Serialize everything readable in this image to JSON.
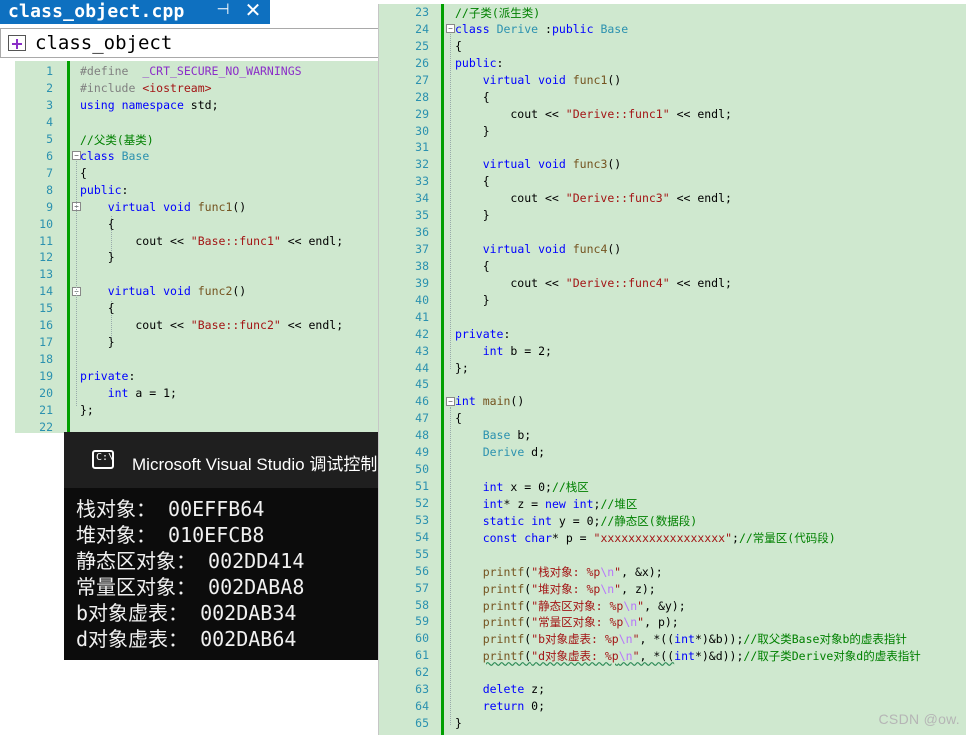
{
  "editor": {
    "tab_title": "class_object.cpp",
    "pin_glyph": "⊣",
    "close_glyph": "✕",
    "nav_class": "class_object"
  },
  "left_lines": [
    {
      "n": "1",
      "segs": [
        [
          "pp",
          "#define  "
        ],
        [
          "mac",
          "_CRT_SECURE_NO_WARNINGS"
        ]
      ]
    },
    {
      "n": "2",
      "segs": [
        [
          "pp",
          "#include "
        ],
        [
          "str",
          "<iostream>"
        ]
      ]
    },
    {
      "n": "3",
      "segs": [
        [
          "kw",
          "using"
        ],
        [
          "nm",
          " "
        ],
        [
          "kw",
          "namespace"
        ],
        [
          "nm",
          " std;"
        ]
      ]
    },
    {
      "n": "4",
      "segs": []
    },
    {
      "n": "5",
      "segs": [
        [
          "cm",
          "//父类(基类)"
        ]
      ]
    },
    {
      "n": "6",
      "segs": [
        [
          "kw",
          "class"
        ],
        [
          "nm",
          " "
        ],
        [
          "ty",
          "Base"
        ]
      ]
    },
    {
      "n": "7",
      "segs": [
        [
          "nm",
          "{"
        ]
      ]
    },
    {
      "n": "8",
      "segs": [
        [
          "kw",
          "public"
        ],
        [
          "nm",
          ":"
        ]
      ]
    },
    {
      "n": "9",
      "segs": [
        [
          "nm",
          "    "
        ],
        [
          "kw",
          "virtual"
        ],
        [
          "nm",
          " "
        ],
        [
          "kw",
          "void"
        ],
        [
          "nm",
          " "
        ],
        [
          "fn",
          "func1"
        ],
        [
          "nm",
          "()"
        ]
      ]
    },
    {
      "n": "10",
      "segs": [
        [
          "nm",
          "    {"
        ]
      ]
    },
    {
      "n": "11",
      "segs": [
        [
          "nm",
          "        cout "
        ],
        [
          "nm",
          "<< "
        ],
        [
          "str",
          "\"Base::func1\""
        ],
        [
          "nm",
          " << endl;"
        ]
      ]
    },
    {
      "n": "12",
      "segs": [
        [
          "nm",
          "    }"
        ]
      ]
    },
    {
      "n": "13",
      "segs": []
    },
    {
      "n": "14",
      "segs": [
        [
          "nm",
          "    "
        ],
        [
          "kw",
          "virtual"
        ],
        [
          "nm",
          " "
        ],
        [
          "kw",
          "void"
        ],
        [
          "nm",
          " "
        ],
        [
          "fn",
          "func2"
        ],
        [
          "nm",
          "()"
        ]
      ]
    },
    {
      "n": "15",
      "segs": [
        [
          "nm",
          "    {"
        ]
      ]
    },
    {
      "n": "16",
      "segs": [
        [
          "nm",
          "        cout "
        ],
        [
          "nm",
          "<< "
        ],
        [
          "str",
          "\"Base::func2\""
        ],
        [
          "nm",
          " << endl;"
        ]
      ]
    },
    {
      "n": "17",
      "segs": [
        [
          "nm",
          "    }"
        ]
      ]
    },
    {
      "n": "18",
      "segs": []
    },
    {
      "n": "19",
      "segs": [
        [
          "kw",
          "private"
        ],
        [
          "nm",
          ":"
        ]
      ]
    },
    {
      "n": "20",
      "segs": [
        [
          "nm",
          "    "
        ],
        [
          "kw",
          "int"
        ],
        [
          "nm",
          " a = 1;"
        ]
      ]
    },
    {
      "n": "21",
      "segs": [
        [
          "nm",
          "};"
        ]
      ]
    },
    {
      "n": "22",
      "segs": []
    }
  ],
  "console": {
    "title": "Microsoft Visual Studio 调试控制台",
    "icon_glyph": "C:\\",
    "lines": [
      "栈对象： 00EFFB64",
      "堆对象： 010EFCB8",
      "静态区对象： 002DD414",
      "常量区对象： 002DABA8",
      "b对象虚表： 002DAB34",
      "d对象虚表： 002DAB64"
    ]
  },
  "right_lines": [
    {
      "n": "23",
      "segs": [
        [
          "cm",
          "//子类(派生类)"
        ]
      ]
    },
    {
      "n": "24",
      "segs": [
        [
          "kw",
          "class"
        ],
        [
          "nm",
          " "
        ],
        [
          "ty",
          "Derive"
        ],
        [
          "nm",
          " :"
        ],
        [
          "kw",
          "public"
        ],
        [
          "nm",
          " "
        ],
        [
          "ty",
          "Base"
        ]
      ]
    },
    {
      "n": "25",
      "segs": [
        [
          "nm",
          "{"
        ]
      ]
    },
    {
      "n": "26",
      "segs": [
        [
          "kw",
          "public"
        ],
        [
          "nm",
          ":"
        ]
      ]
    },
    {
      "n": "27",
      "segs": [
        [
          "nm",
          "    "
        ],
        [
          "kw",
          "virtual"
        ],
        [
          "nm",
          " "
        ],
        [
          "kw",
          "void"
        ],
        [
          "nm",
          " "
        ],
        [
          "fn",
          "func1"
        ],
        [
          "nm",
          "()"
        ]
      ]
    },
    {
      "n": "28",
      "segs": [
        [
          "nm",
          "    {"
        ]
      ]
    },
    {
      "n": "29",
      "segs": [
        [
          "nm",
          "        cout << "
        ],
        [
          "str",
          "\"Derive::func1\""
        ],
        [
          "nm",
          " << endl;"
        ]
      ]
    },
    {
      "n": "30",
      "segs": [
        [
          "nm",
          "    }"
        ]
      ]
    },
    {
      "n": "31",
      "segs": []
    },
    {
      "n": "32",
      "segs": [
        [
          "nm",
          "    "
        ],
        [
          "kw",
          "virtual"
        ],
        [
          "nm",
          " "
        ],
        [
          "kw",
          "void"
        ],
        [
          "nm",
          " "
        ],
        [
          "fn",
          "func3"
        ],
        [
          "nm",
          "()"
        ]
      ]
    },
    {
      "n": "33",
      "segs": [
        [
          "nm",
          "    {"
        ]
      ]
    },
    {
      "n": "34",
      "segs": [
        [
          "nm",
          "        cout << "
        ],
        [
          "str",
          "\"Derive::func3\""
        ],
        [
          "nm",
          " << endl;"
        ]
      ]
    },
    {
      "n": "35",
      "segs": [
        [
          "nm",
          "    }"
        ]
      ]
    },
    {
      "n": "36",
      "segs": []
    },
    {
      "n": "37",
      "segs": [
        [
          "nm",
          "    "
        ],
        [
          "kw",
          "virtual"
        ],
        [
          "nm",
          " "
        ],
        [
          "kw",
          "void"
        ],
        [
          "nm",
          " "
        ],
        [
          "fn",
          "func4"
        ],
        [
          "nm",
          "()"
        ]
      ]
    },
    {
      "n": "38",
      "segs": [
        [
          "nm",
          "    {"
        ]
      ]
    },
    {
      "n": "39",
      "segs": [
        [
          "nm",
          "        cout << "
        ],
        [
          "str",
          "\"Derive::func4\""
        ],
        [
          "nm",
          " << endl;"
        ]
      ]
    },
    {
      "n": "40",
      "segs": [
        [
          "nm",
          "    }"
        ]
      ]
    },
    {
      "n": "41",
      "segs": []
    },
    {
      "n": "42",
      "segs": [
        [
          "kw",
          "private"
        ],
        [
          "nm",
          ":"
        ]
      ]
    },
    {
      "n": "43",
      "segs": [
        [
          "nm",
          "    "
        ],
        [
          "kw",
          "int"
        ],
        [
          "nm",
          " b = 2;"
        ]
      ]
    },
    {
      "n": "44",
      "segs": [
        [
          "nm",
          "};"
        ]
      ]
    },
    {
      "n": "45",
      "segs": []
    },
    {
      "n": "46",
      "segs": [
        [
          "kw",
          "int"
        ],
        [
          "nm",
          " "
        ],
        [
          "fn",
          "main"
        ],
        [
          "nm",
          "()"
        ]
      ]
    },
    {
      "n": "47",
      "segs": [
        [
          "nm",
          "{"
        ]
      ]
    },
    {
      "n": "48",
      "segs": [
        [
          "nm",
          "    "
        ],
        [
          "ty",
          "Base"
        ],
        [
          "nm",
          " b;"
        ]
      ]
    },
    {
      "n": "49",
      "segs": [
        [
          "nm",
          "    "
        ],
        [
          "ty",
          "Derive"
        ],
        [
          "nm",
          " d;"
        ]
      ]
    },
    {
      "n": "50",
      "segs": []
    },
    {
      "n": "51",
      "segs": [
        [
          "nm",
          "    "
        ],
        [
          "kw",
          "int"
        ],
        [
          "nm",
          " x = 0;"
        ],
        [
          "cm",
          "//栈区"
        ]
      ]
    },
    {
      "n": "52",
      "segs": [
        [
          "nm",
          "    "
        ],
        [
          "kw",
          "int"
        ],
        [
          "nm",
          "* z = "
        ],
        [
          "kw",
          "new"
        ],
        [
          "nm",
          " "
        ],
        [
          "kw",
          "int"
        ],
        [
          "nm",
          ";"
        ],
        [
          "cm",
          "//堆区"
        ]
      ]
    },
    {
      "n": "53",
      "segs": [
        [
          "nm",
          "    "
        ],
        [
          "kw",
          "static"
        ],
        [
          "nm",
          " "
        ],
        [
          "kw",
          "int"
        ],
        [
          "nm",
          " y = 0;"
        ],
        [
          "cm",
          "//静态区(数据段)"
        ]
      ]
    },
    {
      "n": "54",
      "segs": [
        [
          "nm",
          "    "
        ],
        [
          "kw",
          "const"
        ],
        [
          "nm",
          " "
        ],
        [
          "kw",
          "char"
        ],
        [
          "nm",
          "* p = "
        ],
        [
          "str",
          "\"xxxxxxxxxxxxxxxxxx\""
        ],
        [
          "nm",
          ";"
        ],
        [
          "cm",
          "//常量区(代码段)"
        ]
      ]
    },
    {
      "n": "55",
      "segs": []
    },
    {
      "n": "56",
      "segs": [
        [
          "nm",
          "    "
        ],
        [
          "fn",
          "printf"
        ],
        [
          "nm",
          "("
        ],
        [
          "str",
          "\"栈对象: %p"
        ],
        [
          "esc",
          "\\n"
        ],
        [
          "str",
          "\""
        ],
        [
          "nm",
          ", &x);"
        ]
      ]
    },
    {
      "n": "57",
      "segs": [
        [
          "nm",
          "    "
        ],
        [
          "fn",
          "printf"
        ],
        [
          "nm",
          "("
        ],
        [
          "str",
          "\"堆对象: %p"
        ],
        [
          "esc",
          "\\n"
        ],
        [
          "str",
          "\""
        ],
        [
          "nm",
          ", z);"
        ]
      ]
    },
    {
      "n": "58",
      "segs": [
        [
          "nm",
          "    "
        ],
        [
          "fn",
          "printf"
        ],
        [
          "nm",
          "("
        ],
        [
          "str",
          "\"静态区对象: %p"
        ],
        [
          "esc",
          "\\n"
        ],
        [
          "str",
          "\""
        ],
        [
          "nm",
          ", &y);"
        ]
      ]
    },
    {
      "n": "59",
      "segs": [
        [
          "nm",
          "    "
        ],
        [
          "fn",
          "printf"
        ],
        [
          "nm",
          "("
        ],
        [
          "str",
          "\"常量区对象: %p"
        ],
        [
          "esc",
          "\\n"
        ],
        [
          "str",
          "\""
        ],
        [
          "nm",
          ", p);"
        ]
      ]
    },
    {
      "n": "60",
      "segs": [
        [
          "nm",
          "    "
        ],
        [
          "fn",
          "printf"
        ],
        [
          "nm",
          "("
        ],
        [
          "str",
          "\"b对象虚表: %p"
        ],
        [
          "esc",
          "\\n"
        ],
        [
          "str",
          "\""
        ],
        [
          "nm",
          ", *(("
        ],
        [
          "kw",
          "int"
        ],
        [
          "nm",
          "*)&b));"
        ],
        [
          "cm",
          "//取父类Base对象b的虚表指针"
        ]
      ]
    },
    {
      "n": "61",
      "segs": [
        [
          "nm",
          "    "
        ],
        [
          "fn",
          "printf"
        ],
        [
          "nm",
          "("
        ],
        [
          "str",
          "\"d对象虚表: %p"
        ],
        [
          "esc",
          "\\n"
        ],
        [
          "str",
          "\""
        ],
        [
          "nm",
          ", *(("
        ],
        [
          "kw",
          "int"
        ],
        [
          "nm",
          "*)&d));"
        ],
        [
          "cm",
          "//取子类Derive对象d的虚表指针"
        ]
      ]
    },
    {
      "n": "62",
      "segs": []
    },
    {
      "n": "63",
      "segs": [
        [
          "nm",
          "    "
        ],
        [
          "kw",
          "delete"
        ],
        [
          "nm",
          " z;"
        ]
      ]
    },
    {
      "n": "64",
      "segs": [
        [
          "nm",
          "    "
        ],
        [
          "kw",
          "return"
        ],
        [
          "nm",
          " 0;"
        ]
      ]
    },
    {
      "n": "65",
      "segs": [
        [
          "nm",
          "}"
        ]
      ]
    }
  ],
  "watermark": "CSDN @ow.",
  "colors": {
    "editor_bg": "#cfe8cf",
    "tab_active": "#0e70c0",
    "keyword": "#0000ff",
    "type": "#2b91af",
    "string": "#a31515",
    "comment": "#008000",
    "change_bar": "#00a000",
    "console_bg": "#0c0c0c"
  }
}
